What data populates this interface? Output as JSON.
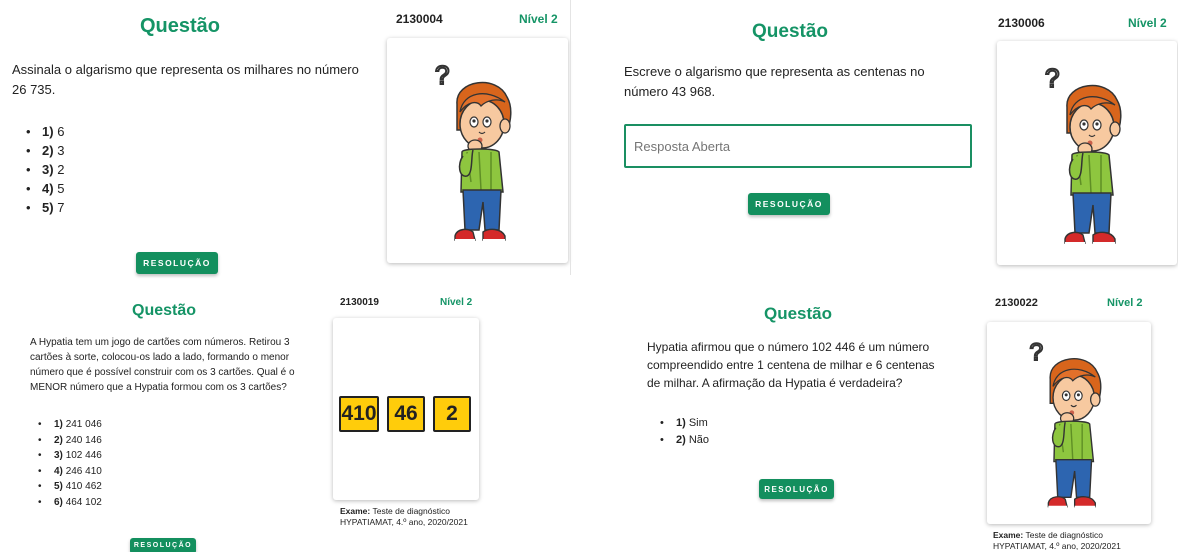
{
  "cards": [
    {
      "title": "Questão",
      "code": "2130004",
      "level": "Nível 2",
      "question": "Assinala o algarismo que representa os milhares no número 26 735.",
      "options": [
        {
          "num": "1)",
          "text": "6"
        },
        {
          "num": "2)",
          "text": "3"
        },
        {
          "num": "3)",
          "text": "2"
        },
        {
          "num": "4)",
          "text": "5"
        },
        {
          "num": "5)",
          "text": "7"
        }
      ],
      "button": "RESOLUÇÃO",
      "illustration": "thinking-boy-icon"
    },
    {
      "title": "Questão",
      "code": "2130006",
      "level": "Nível 2",
      "question": "Escreve o algarismo que representa as centenas no número 43 968.",
      "answer_placeholder": "Resposta Aberta",
      "button": "RESOLUÇÃO",
      "illustration": "thinking-boy-icon"
    },
    {
      "title": "Questão",
      "code": "2130019",
      "level": "Nível 2",
      "question": "A Hypatia tem um jogo de cartões com números. Retirou 3 cartões à sorte, colocou-os lado a lado, formando o menor número que é possível construir com os 3 cartões. Qual é o MENOR número que a Hypatia formou com os 3 cartões?",
      "options": [
        {
          "num": "1)",
          "text": "241 046"
        },
        {
          "num": "2)",
          "text": "240 146"
        },
        {
          "num": "3)",
          "text": "102 446"
        },
        {
          "num": "4)",
          "text": "246 410"
        },
        {
          "num": "5)",
          "text": "410 462"
        },
        {
          "num": "6)",
          "text": "464 102"
        }
      ],
      "number_cards": [
        "410",
        "46",
        "2"
      ],
      "exam_label": "Exame:",
      "exam_text": "Teste de diagnóstico HYPATIAMAT, 4.º ano, 2020/2021",
      "button": "RESOLUÇÃO"
    },
    {
      "title": "Questão",
      "code": "2130022",
      "level": "Nível 2",
      "question": "Hypatia afirmou que o número 102 446 é um número compreendido entre 1 centena de milhar e 6 centenas de milhar. A afirmação da Hypatia é verdadeira?",
      "options": [
        {
          "num": "1)",
          "text": "Sim"
        },
        {
          "num": "2)",
          "text": "Não"
        }
      ],
      "exam_label": "Exame:",
      "exam_text": "Teste de diagnóstico HYPATIAMAT, 4.º ano, 2020/2021",
      "button": "RESOLUÇÃO",
      "illustration": "thinking-boy-icon"
    }
  ],
  "colors": {
    "accent": "#159466",
    "button": "#138f5e",
    "card_yellow": "#ffcc0b"
  }
}
